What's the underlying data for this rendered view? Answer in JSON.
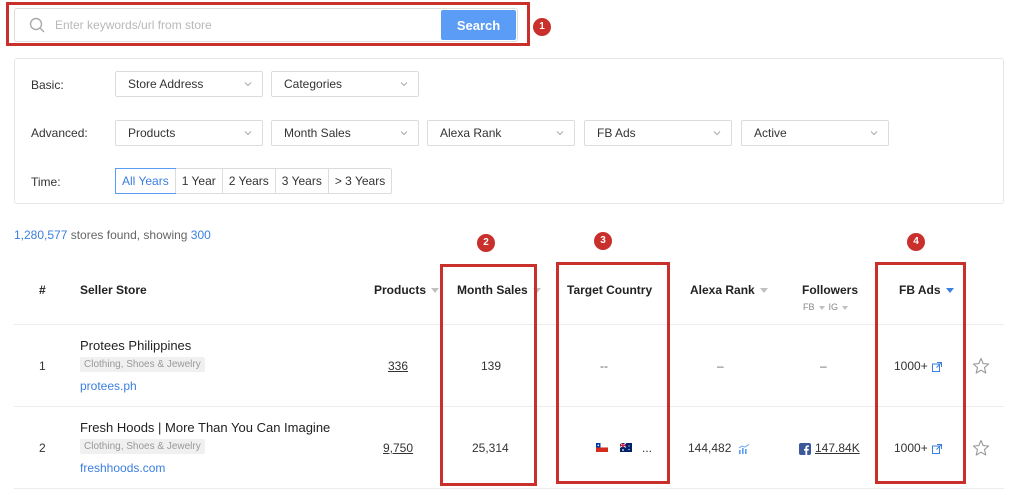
{
  "search": {
    "placeholder": "Enter keywords/url from store",
    "button_label": "Search"
  },
  "annotations": [
    "1",
    "2",
    "3",
    "4"
  ],
  "filters": {
    "basic_label": "Basic:",
    "basic": [
      "Store Address",
      "Categories"
    ],
    "advanced_label": "Advanced:",
    "advanced": [
      "Products",
      "Month Sales",
      "Alexa Rank",
      "FB Ads",
      "Active"
    ],
    "time_label": "Time:",
    "time_options": [
      "All Years",
      "1 Year",
      "2 Years",
      "3 Years",
      "> 3 Years"
    ],
    "time_selected": "All Years"
  },
  "results": {
    "total": "1,280,577",
    "middle_text": " stores found, showing ",
    "showing": "300"
  },
  "table": {
    "headers": {
      "index": "#",
      "seller_store": "Seller Store",
      "products": "Products",
      "month_sales": "Month Sales",
      "target_country": "Target Country",
      "alexa_rank": "Alexa Rank",
      "followers": "Followers",
      "followers_fb": "FB",
      "followers_ig": "IG",
      "fb_ads": "FB Ads"
    },
    "rows": [
      {
        "index": "1",
        "name": "Protees Philippines",
        "category": "Clothing, Shoes & Jewelry",
        "url": "protees.ph",
        "products": "336",
        "month_sales": "139",
        "target_country": "--",
        "alexa_rank": "–",
        "followers": "–",
        "fb_ads": "1000+"
      },
      {
        "index": "2",
        "name": "Fresh Hoods | More Than You Can Imagine",
        "category": "Clothing, Shoes & Jewelry",
        "url": "freshhoods.com",
        "products": "9,750",
        "month_sales": "25,314",
        "target_country_more": "...",
        "alexa_rank": "144,482",
        "followers": "147.84K",
        "fb_ads": "1000+"
      }
    ]
  },
  "colors": {
    "accent": "#5b9cf6",
    "link": "#3b7fe0",
    "annotation_red": "#c9302c"
  }
}
